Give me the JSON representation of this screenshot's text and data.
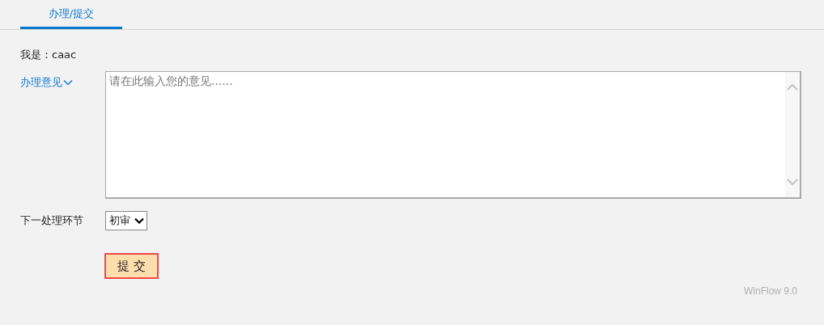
{
  "tabs": [
    {
      "label": "办理/提交",
      "selected": true
    }
  ],
  "user": {
    "label": "我是：",
    "value": "caac"
  },
  "opinion": {
    "label": "办理意见",
    "placeholder": "请在此输入您的意见......"
  },
  "next_step": {
    "label": "下一处理环节",
    "value": "初审"
  },
  "submit_button": "提 交",
  "version": "WinFlow 9.0"
}
